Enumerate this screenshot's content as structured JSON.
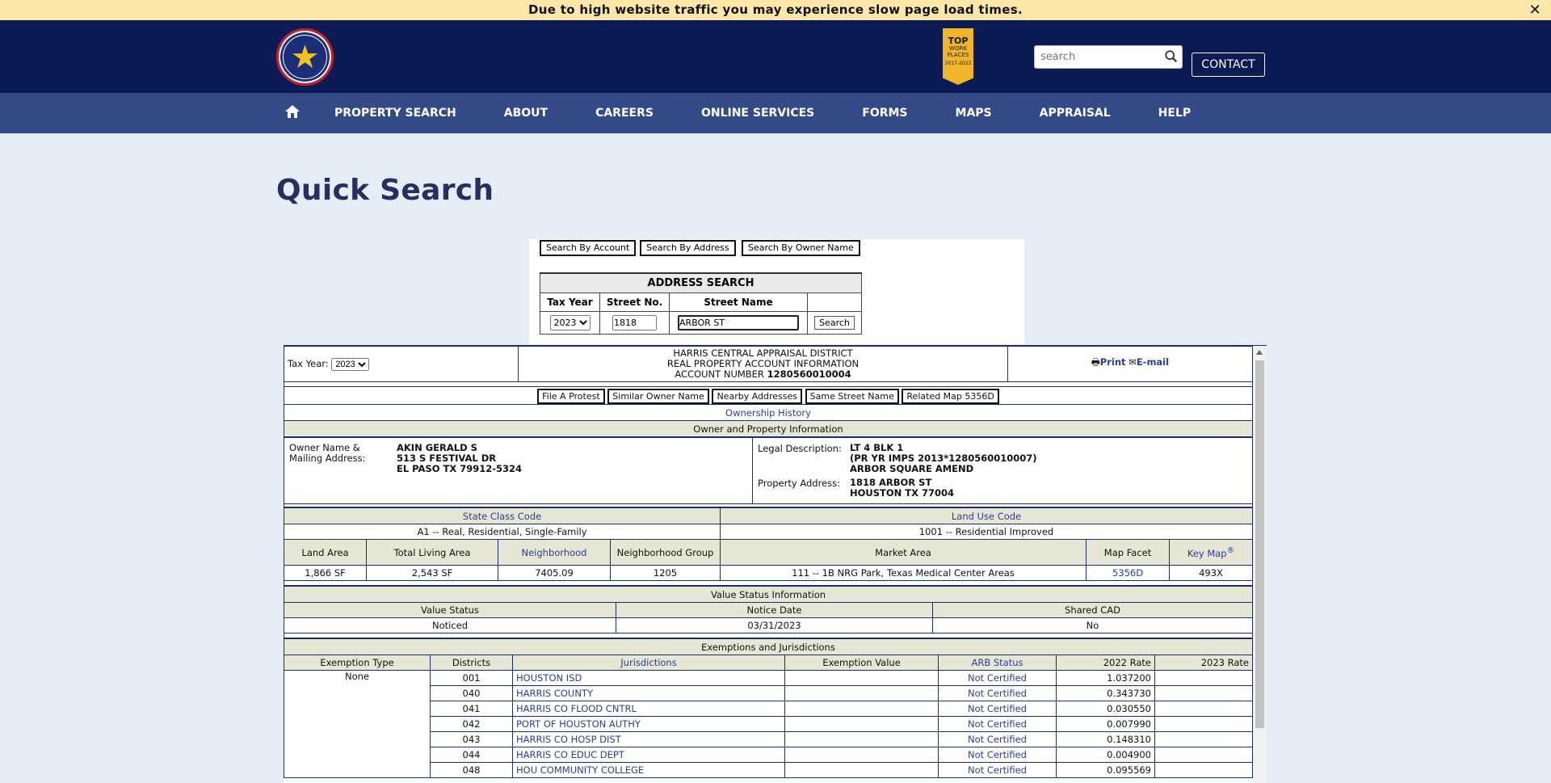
{
  "banner": {
    "text": "Due to high website traffic you may experience slow page load times.",
    "close": "✕"
  },
  "header": {
    "award": {
      "line1": "TOP",
      "line2": "WORK",
      "line3": "PLACES",
      "years": "2017-2022"
    },
    "search_placeholder": "search",
    "contact_label": "CONTACT"
  },
  "nav": {
    "items": [
      "PROPERTY SEARCH",
      "ABOUT",
      "CAREERS",
      "ONLINE SERVICES",
      "FORMS",
      "MAPS",
      "APPRAISAL",
      "HELP"
    ]
  },
  "page_title": "Quick Search",
  "quick_search": {
    "buttons": [
      "Search By Account",
      "Search By Address",
      "Search By Owner Name"
    ],
    "address_search": {
      "caption": "ADDRESS SEARCH",
      "headers": [
        "Tax Year",
        "Street No.",
        "Street Name"
      ],
      "tax_year": "2023",
      "street_no": "1818",
      "street_name": "ARBOR ST",
      "search_label": "Search"
    }
  },
  "record": {
    "tax_year_label": "Tax Year:",
    "tax_year": "2023",
    "district_lines": [
      "HARRIS CENTRAL APPRAISAL DISTRICT",
      "REAL PROPERTY ACCOUNT INFORMATION"
    ],
    "account_label": "ACCOUNT NUMBER",
    "account_number": "1280560010004",
    "print_label": "Print",
    "email_label": "E-mail",
    "action_buttons": [
      "File A Protest",
      "Similar Owner Name",
      "Nearby Addresses",
      "Same Street Name",
      "Related Map 5356D"
    ],
    "ownership_history": "Ownership History",
    "owner_section_title": "Owner and Property Information",
    "owner_label_1": "Owner Name &",
    "owner_label_2": "Mailing Address:",
    "owner_lines": [
      "AKIN GERALD S",
      "513 S FESTIVAL DR",
      "EL PASO TX 79912-5324"
    ],
    "legal_label": "Legal Description:",
    "legal_lines": [
      "LT 4 BLK 1",
      "(PR YR IMPS 2013*1280560010007)",
      "ARBOR SQUARE AMEND"
    ],
    "property_address_label": "Property Address:",
    "property_address_lines": [
      "1818 ARBOR ST",
      "HOUSTON TX 77004"
    ],
    "state_class_label": "State Class Code",
    "state_class_value": "A1 -- Real, Residential, Single-Family",
    "land_use_label": "Land Use Code",
    "land_use_value": "1001 -- Residential Improved",
    "attr_headers": [
      "Land Area",
      "Total Living Area",
      "Neighborhood",
      "Neighborhood Group",
      "Market Area",
      "Map Facet",
      "Key Map"
    ],
    "key_map_mark": "®",
    "attr_values": [
      "1,866 SF",
      "2,543 SF",
      "7405.09",
      "1205",
      "111 -- 1B NRG Park, Texas Medical Center Areas",
      "5356D",
      "493X"
    ],
    "value_status_title": "Value Status Information",
    "value_status_headers": [
      "Value Status",
      "Notice Date",
      "Shared CAD"
    ],
    "value_status_values": [
      "Noticed",
      "03/31/2023",
      "No"
    ],
    "exemptions_title": "Exemptions and Jurisdictions",
    "exemption_headers": [
      "Exemption Type",
      "Districts",
      "Jurisdictions",
      "Exemption Value",
      "ARB Status",
      "2022 Rate",
      "2023 Rate"
    ],
    "exemption_type": "None",
    "jurisdictions": [
      {
        "district": "001",
        "name": "HOUSTON ISD",
        "arb": "Not Certified",
        "rate_2022": "1.037200"
      },
      {
        "district": "040",
        "name": "HARRIS COUNTY",
        "arb": "Not Certified",
        "rate_2022": "0.343730"
      },
      {
        "district": "041",
        "name": "HARRIS CO FLOOD CNTRL",
        "arb": "Not Certified",
        "rate_2022": "0.030550"
      },
      {
        "district": "042",
        "name": "PORT OF HOUSTON AUTHY",
        "arb": "Not Certified",
        "rate_2022": "0.007990"
      },
      {
        "district": "043",
        "name": "HARRIS CO HOSP DIST",
        "arb": "Not Certified",
        "rate_2022": "0.148310"
      },
      {
        "district": "044",
        "name": "HARRIS CO EDUC DEPT",
        "arb": "Not Certified",
        "rate_2022": "0.004900"
      },
      {
        "district": "048",
        "name": "HOU COMMUNITY COLLEGE",
        "arb": "Not Certified",
        "rate_2022": "0.095569"
      }
    ]
  }
}
